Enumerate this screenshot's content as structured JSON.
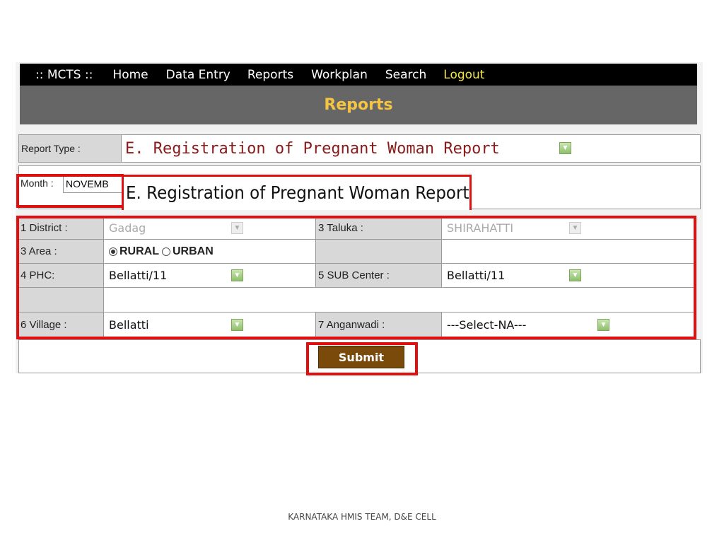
{
  "nav": {
    "brand": ":: MCTS ::",
    "items": [
      "Home",
      "Data Entry",
      "Reports",
      "Workplan",
      "Search"
    ],
    "logout": "Logout"
  },
  "page_title": "Reports",
  "report_type": {
    "label": "Report Type :",
    "value": "E. Registration of Pregnant Woman Report"
  },
  "month": {
    "label": "Month :",
    "value": "NOVEMB",
    "overlay_title": "E. Registration of Pregnant Woman Report"
  },
  "form": {
    "district_label": "1 District :",
    "district_value": "Gadag",
    "taluka_label": "3 Taluka :",
    "taluka_value": "SHIRAHATTI",
    "area_label": "3 Area :",
    "area_rural": "RURAL",
    "area_urban": "URBAN",
    "phc_label": "4 PHC:",
    "phc_value": "Bellatti/11",
    "subcenter_label": "5 SUB Center :",
    "subcenter_value": "Bellatti/11",
    "village_label": "6 Village :",
    "village_value": "Bellatti",
    "anganwadi_label": "7 Anganwadi :",
    "anganwadi_value": "---Select-NA---"
  },
  "submit_label": "Submit",
  "footer": "KARNATAKA HMIS TEAM, D&E CELL",
  "colors": {
    "highlight": "#e01010",
    "title": "#f5c542",
    "submit_bg": "#7a4a0a"
  }
}
